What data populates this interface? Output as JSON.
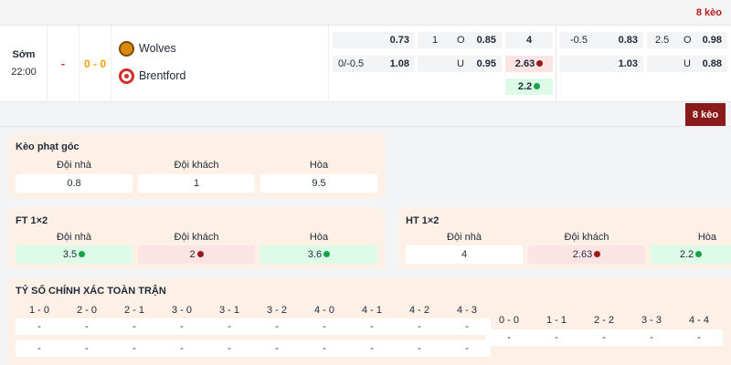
{
  "top_strip": {
    "keo_label": "8 kèo"
  },
  "match": {
    "status": "Sớm",
    "time": "22:00",
    "dash": "-",
    "score": "0 - 0",
    "home_team": "Wolves",
    "away_team": "Brentford",
    "odds": {
      "row1": {
        "hdp_value": "0.73",
        "ou_line": "1",
        "ou_side": "O",
        "ou_value": "0.85",
        "x12_value": "4",
        "hdp2_line": "-0.5",
        "hdp2_value": "0.83",
        "ou2_line": "2.5",
        "ou2_side": "O",
        "ou2_value": "0.98"
      },
      "row2": {
        "hdp_line": "0/-0.5",
        "hdp_value": "1.08",
        "ou_side": "U",
        "ou_value": "0.95",
        "x12_value": "2.63",
        "hdp2_value": "1.03",
        "ou2_side": "U",
        "ou2_value": "0.88"
      },
      "row3": {
        "x12_value": "2.2"
      }
    }
  },
  "keo_tab": "8 kèo",
  "corners": {
    "title": "Kèo phạt góc",
    "headers": [
      "Đội nhà",
      "Đội khách",
      "Hòa"
    ],
    "values": [
      "0.8",
      "1",
      "9.5"
    ]
  },
  "ft": {
    "title": "FT 1×2",
    "headers": [
      "Đội nhà",
      "Đội khách",
      "Hòa"
    ],
    "values": [
      "3.5",
      "2",
      "3.6"
    ]
  },
  "ht": {
    "title": "HT 1×2",
    "headers": [
      "Đội nhà",
      "Đội khách",
      "Hòa"
    ],
    "values": [
      "4",
      "2.63",
      "2.2"
    ]
  },
  "correct_score": {
    "title": "TỶ SỐ CHÍNH XÁC TOÀN TRẬN",
    "home_scores": [
      "1 - 0",
      "2 - 0",
      "2 - 1",
      "3 - 0",
      "3 - 1",
      "3 - 2",
      "4 - 0",
      "4 - 1",
      "4 - 2",
      "4 - 3"
    ],
    "draw_scores": [
      "0 - 0",
      "1 - 1",
      "2 - 2",
      "3 - 3",
      "4 - 4"
    ],
    "empty": "-"
  },
  "colors": {
    "accent_red": "#8b1a1a",
    "score_orange": "#f59e0b",
    "dot_green": "#16a34a",
    "dot_red": "#991b1b"
  }
}
